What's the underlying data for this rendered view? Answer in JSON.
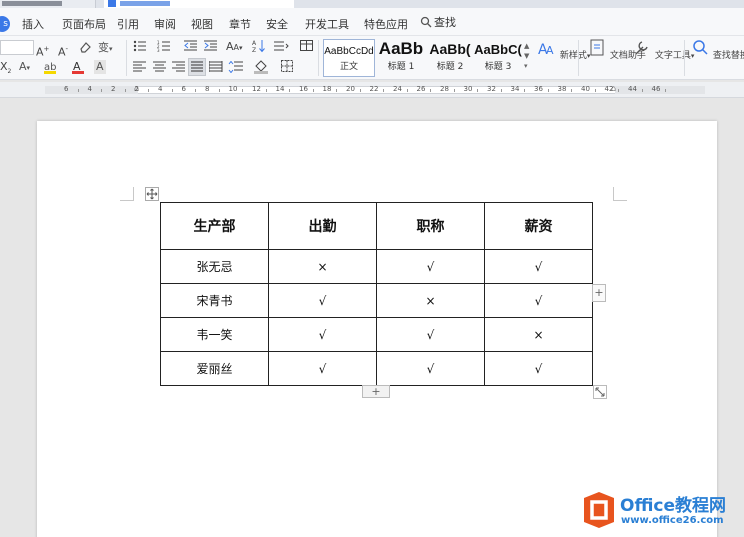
{
  "menu": {
    "items": [
      "插入",
      "页面布局",
      "引用",
      "审阅",
      "视图",
      "章节",
      "安全",
      "开发工具",
      "特色应用"
    ],
    "search_label": "查找"
  },
  "ribbon": {
    "styles": [
      {
        "sample": "AaBbCcDd",
        "caption": "正文"
      },
      {
        "sample": "AaBb",
        "caption": "标题 1"
      },
      {
        "sample": "AaBb(",
        "caption": "标题 2"
      },
      {
        "sample": "AaBbC(",
        "caption": "标题 3"
      }
    ],
    "new_style_label": "新样式",
    "doc_helper_label": "文档助手",
    "text_tools_label": "文字工具",
    "find_replace_label": "查找替换",
    "font_color_accent": "#e53935",
    "highlight_color": "#f5d800"
  },
  "ruler": {
    "numbers": [
      "6",
      "4",
      "2",
      "2",
      "4",
      "6",
      "8",
      "10",
      "12",
      "14",
      "16",
      "18",
      "20",
      "22",
      "24",
      "26",
      "28",
      "30",
      "32",
      "34",
      "36",
      "38",
      "40",
      "42",
      "44",
      "46"
    ]
  },
  "table": {
    "headers": [
      "生产部",
      "出勤",
      "职称",
      "薪资"
    ],
    "rows": [
      [
        "张无忌",
        "×",
        "√",
        "√"
      ],
      [
        "宋青书",
        "√",
        "×",
        "√"
      ],
      [
        "韦一笑",
        "√",
        "√",
        "×"
      ],
      [
        "爱丽丝",
        "√",
        "√",
        "√"
      ]
    ]
  },
  "watermark": {
    "title": "Office教程网",
    "url": "www.office26.com",
    "logo_color": "#e8541e",
    "text_color": "#2a7fd4"
  }
}
